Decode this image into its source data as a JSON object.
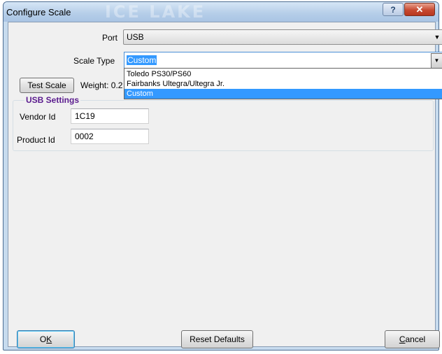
{
  "window": {
    "title": "Configure Scale",
    "watermark": "ICE LAKE",
    "help_glyph": "?",
    "close_glyph": "✕"
  },
  "port": {
    "label": "Port",
    "value": "USB",
    "arrow": "▼"
  },
  "scale_type": {
    "label": "Scale Type",
    "value": "Custom",
    "arrow": "▼",
    "options": [
      "Toledo PS30/PS60",
      "Fairbanks Ultegra/Ultegra Jr.",
      "Custom"
    ],
    "selected_index": 2
  },
  "test": {
    "button_label": "Test Scale",
    "weight_text": "Weight: 0.2"
  },
  "usb_settings": {
    "legend": "USB Settings",
    "vendor_label": "Vendor Id",
    "vendor_value": "1C19",
    "product_label": "Product Id",
    "product_value": "0002"
  },
  "footer": {
    "ok_accel": "K",
    "ok_prefix": "O",
    "reset_label": "Reset Defaults",
    "cancel_accel": "C",
    "cancel_rest": "ancel"
  }
}
